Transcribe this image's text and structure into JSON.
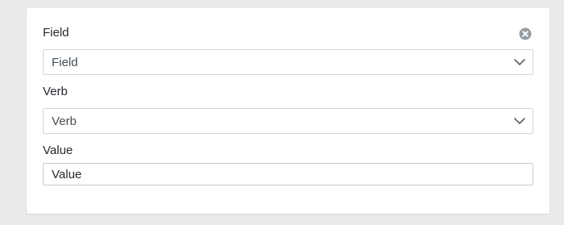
{
  "filter": {
    "field": {
      "label": "Field",
      "selected": "Field"
    },
    "verb": {
      "label": "Verb",
      "selected": "Verb"
    },
    "value": {
      "label": "Value",
      "placeholder": "Value",
      "value": ""
    },
    "icons": {
      "remove": "close-circle-icon",
      "dropdown": "chevron-down-icon"
    }
  },
  "colors": {
    "background": "#e9ebed",
    "card": "#ffffff",
    "border": "#d1d5da",
    "text": "#24292e",
    "icon": "#959da5"
  }
}
